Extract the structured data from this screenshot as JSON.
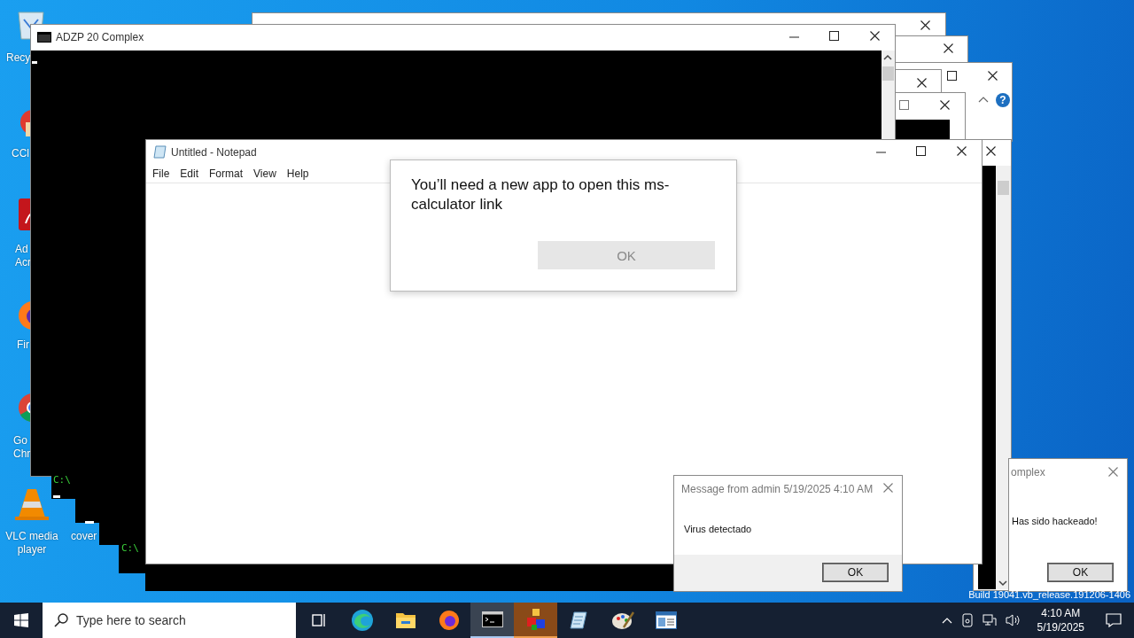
{
  "desktop_icons": [
    {
      "kind": "recycle-bin",
      "lines": [
        "Recy"
      ]
    },
    {
      "kind": "ccleaner",
      "lines": [
        "CCl"
      ]
    },
    {
      "kind": "acrobat",
      "lines": [
        "Ad",
        "Acr"
      ]
    },
    {
      "kind": "firefox",
      "lines": [
        "Fir"
      ]
    },
    {
      "kind": "chrome",
      "lines": [
        "Go",
        "Chr"
      ]
    },
    {
      "kind": "vlc",
      "lines": [
        "VLC media",
        "player"
      ]
    },
    {
      "kind": "covered",
      "lines": [
        "cover"
      ]
    }
  ],
  "console_window": {
    "title": "ADZP 20 Complex"
  },
  "small_consoles": [
    {
      "prompt": "C:\\"
    },
    {
      "prompt": "C:\\"
    }
  ],
  "help_glyph": "?",
  "notepad": {
    "title": "Untitled - Notepad",
    "menu": [
      "File",
      "Edit",
      "Format",
      "View",
      "Help"
    ]
  },
  "app_prompt": {
    "message": "You’ll need a new app to open this ms-calculator link",
    "button": {
      "label": "OK",
      "disabled": true
    }
  },
  "admin_message": {
    "title": "Message from admin 5/19/2025 4:10 AM",
    "text": "Virus detectado",
    "button": "OK"
  },
  "hack_message": {
    "title": "omplex",
    "text": "Has sido hackeado!",
    "button": "OK"
  },
  "build_info": "Build 19041.vb_release.191206-1406",
  "taskbar": {
    "search": {
      "placeholder": "Type here to search"
    },
    "apps": [
      {
        "kind": "task-view",
        "open": false,
        "selected": false
      },
      {
        "kind": "edge",
        "open": false,
        "selected": false
      },
      {
        "kind": "explorer",
        "open": false,
        "selected": false
      },
      {
        "kind": "firefox",
        "open": false,
        "selected": false
      },
      {
        "kind": "console",
        "open": true,
        "selected": false
      },
      {
        "kind": "cubes",
        "open": true,
        "selected": true
      },
      {
        "kind": "notepad",
        "open": false,
        "selected": false
      },
      {
        "kind": "paint",
        "open": false,
        "selected": false
      },
      {
        "kind": "window",
        "open": false,
        "selected": false
      }
    ],
    "time": "4:10 AM",
    "date": "5/19/2025"
  }
}
